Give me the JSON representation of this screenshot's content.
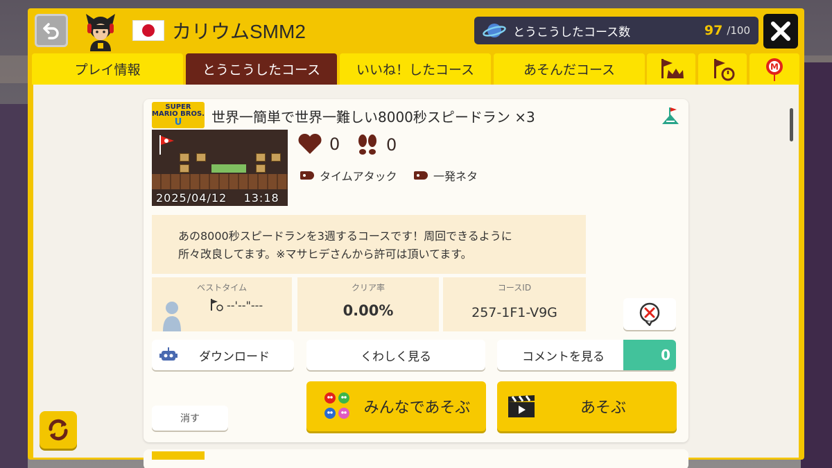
{
  "header": {
    "username": "カリウムSMM2",
    "uploaded_label": "とうこうしたコース数",
    "uploaded_count": "97",
    "uploaded_max": "/100"
  },
  "tabs": [
    {
      "label": "プレイ情報"
    },
    {
      "label": "とうこうしたコース"
    },
    {
      "label": "いいね！したコース"
    },
    {
      "label": "あそんだコース"
    }
  ],
  "icon_tabs": [
    "flag-crown-icon",
    "flag-timer-icon",
    "mario-balloon-icon"
  ],
  "course": {
    "game_logo_top": "SUPER",
    "game_logo_mid": "MARIO BROS.",
    "game_logo_u": "U",
    "title": "世界一簡単で世界一難しい8000秒スピードラン ×3",
    "date": "2025/04/12",
    "time": "13:18",
    "likes": "0",
    "plays": "0",
    "tags": [
      "タイムアタック",
      "一発ネタ"
    ],
    "description_line1": "あの8000秒スピードランを3週するコースです！周回できるように",
    "description_line2": "所々改良してます。※マサヒデさんから許可は頂いてます。",
    "best_time_label": "ベストタイム",
    "best_time_value": "--'--\"---",
    "clear_rate_label": "クリア率",
    "clear_rate_value": "0.00%",
    "course_id_label": "コースID",
    "course_id_value": "257-1F1-V9G"
  },
  "buttons": {
    "download": "ダウンロード",
    "details": "くわしく見る",
    "comments": "コメントを見る",
    "comments_count": "0",
    "multiplayer": "みんなであそぶ",
    "play": "あそぶ",
    "delete": "消す"
  },
  "colors": {
    "frame_yellow": "#f3c500",
    "tab_active": "#6a2418",
    "comment_green": "#42c29b",
    "counter_bg": "#34344a"
  }
}
